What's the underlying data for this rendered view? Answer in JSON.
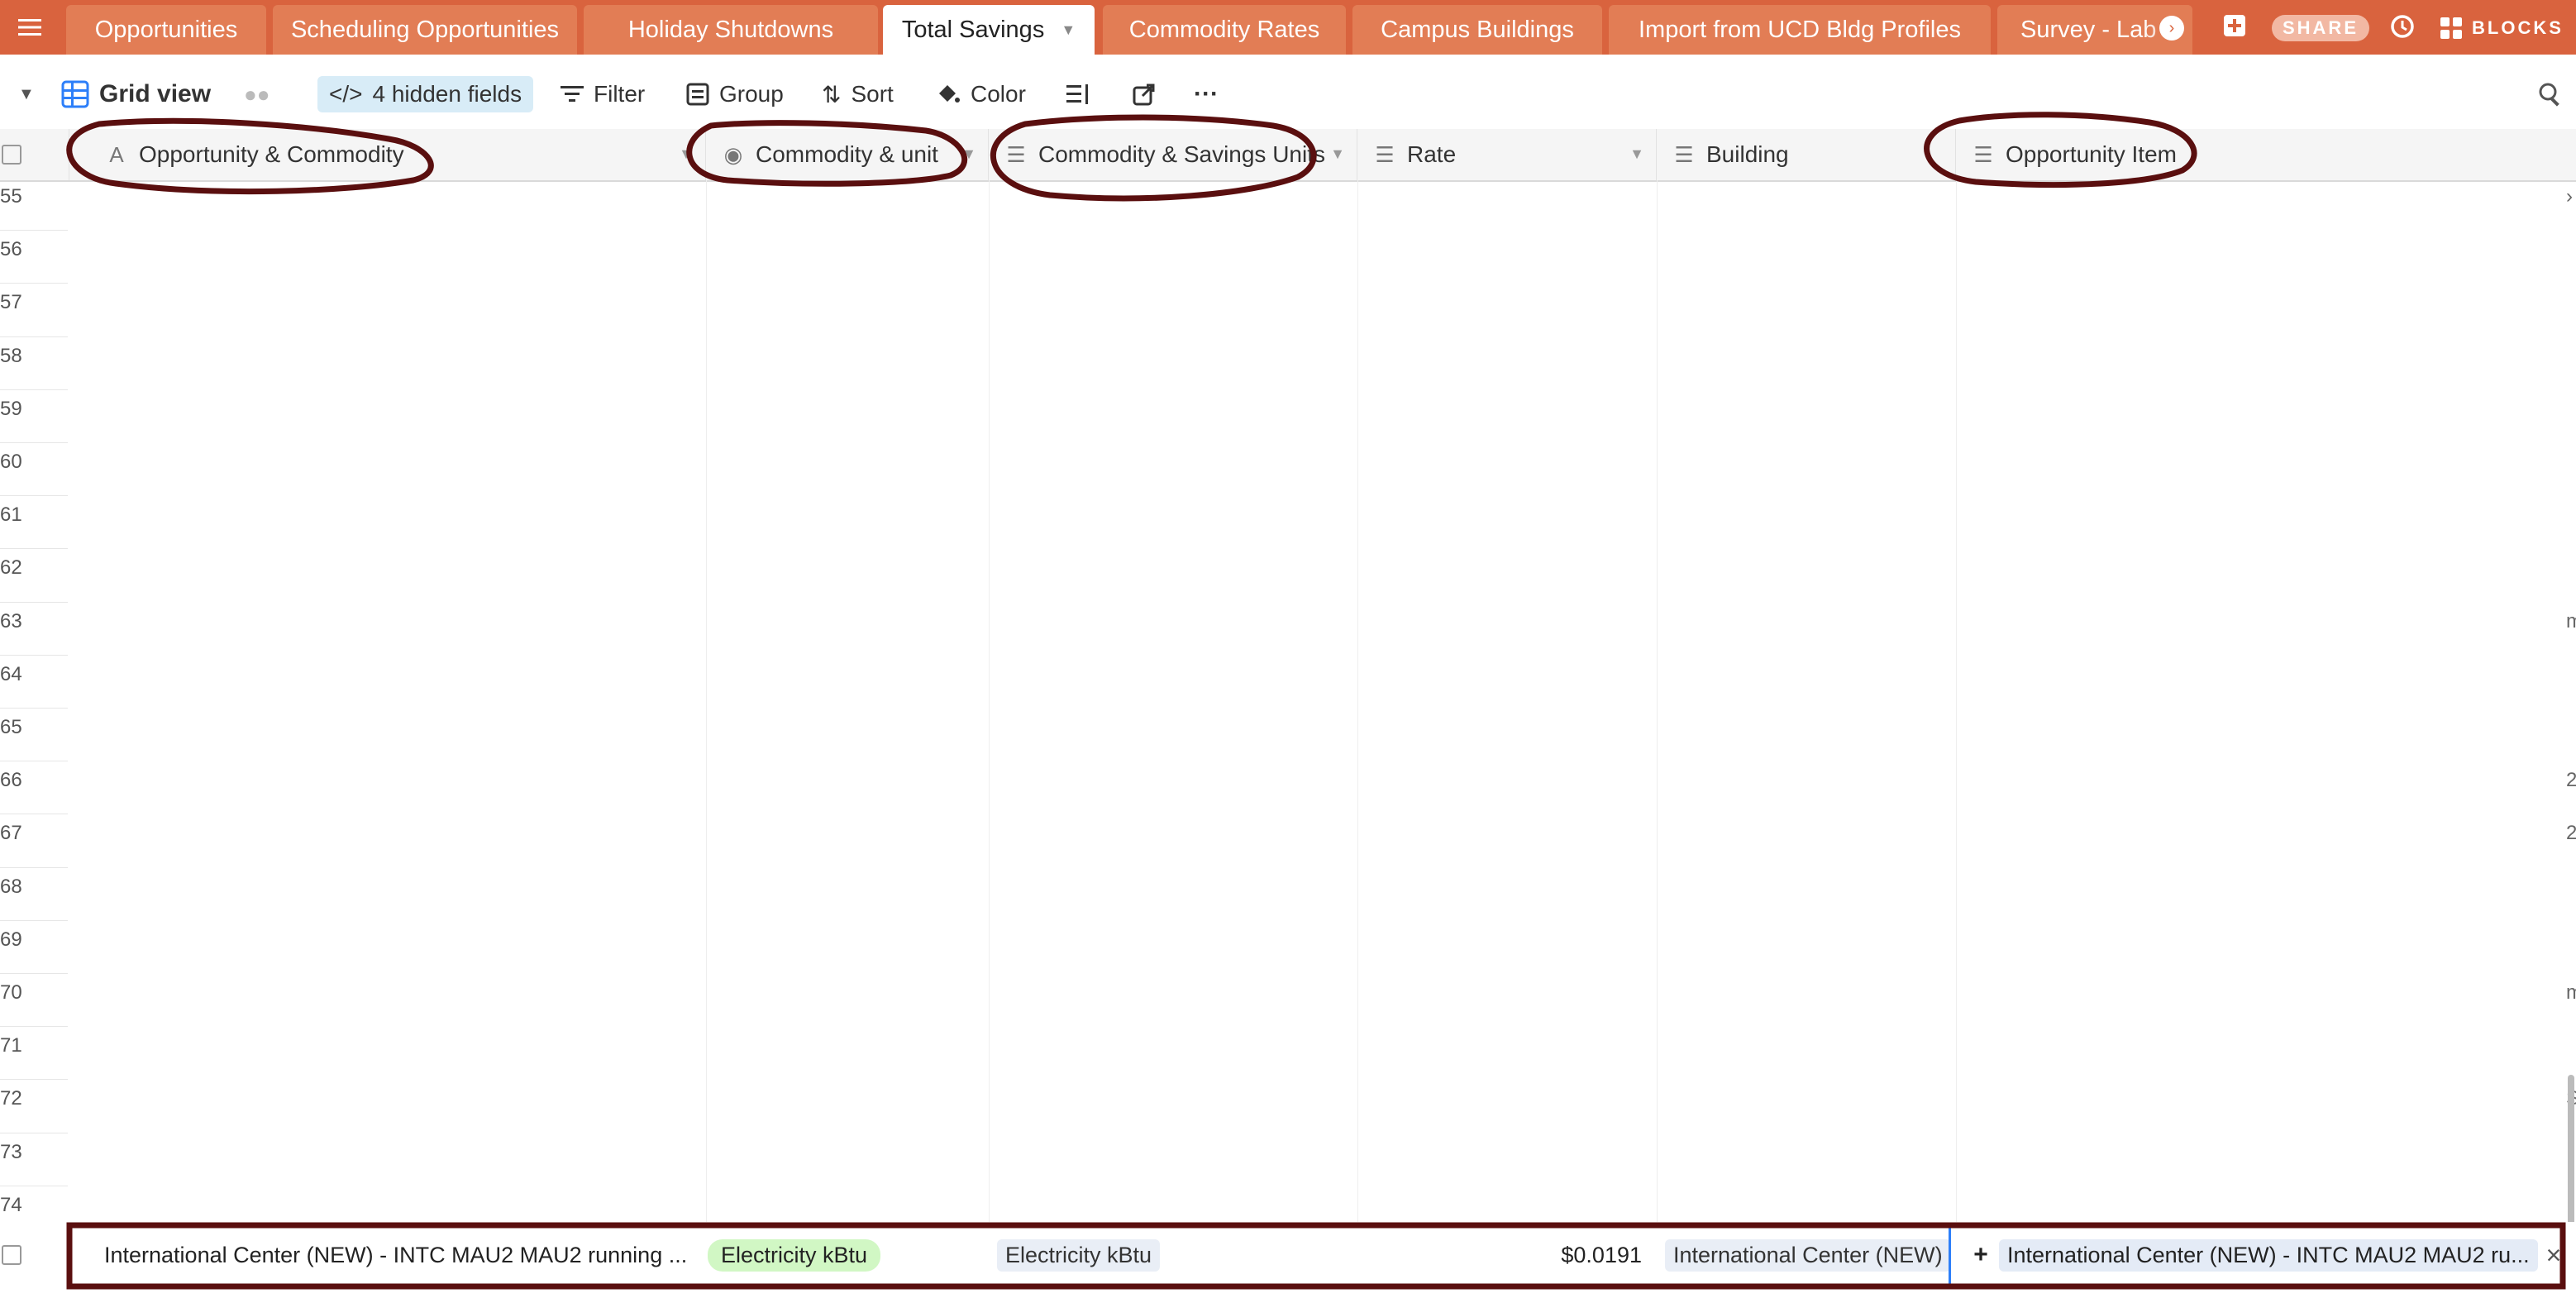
{
  "tabs": [
    {
      "label": "Opportunities"
    },
    {
      "label": "Scheduling Opportunities"
    },
    {
      "label": "Holiday Shutdowns"
    },
    {
      "label": "Total Savings",
      "active": true
    },
    {
      "label": "Commodity Rates"
    },
    {
      "label": "Campus Buildings"
    },
    {
      "label": "Import from UCD Bldg Profiles"
    },
    {
      "label": "Survey - Lab"
    }
  ],
  "topbar": {
    "share_label": "SHARE",
    "blocks_label": "BLOCKS"
  },
  "toolbar": {
    "view_name": "Grid view",
    "hidden_fields": "4 hidden fields",
    "filter": "Filter",
    "group": "Group",
    "sort": "Sort",
    "color": "Color",
    "more": "···"
  },
  "columns": [
    {
      "label": "Opportunity & Commodity",
      "icon": "text-icon"
    },
    {
      "label": "Commodity & unit",
      "icon": "select-icon"
    },
    {
      "label": "Commodity & Savings Units",
      "icon": "lookup-icon"
    },
    {
      "label": "Rate",
      "icon": "lookup-icon"
    },
    {
      "label": "Building",
      "icon": "lookup-icon"
    },
    {
      "label": "Opportunity Item",
      "icon": "link-icon"
    }
  ],
  "row_numbers": [
    "55",
    "56",
    "57",
    "58",
    "59",
    "60",
    "61",
    "62",
    "63",
    "64",
    "65",
    "66",
    "67",
    "68",
    "69",
    "70",
    "71",
    "72",
    "73",
    "74"
  ],
  "right_edge_fragments": [
    "›",
    "m",
    "2",
    "2",
    "m",
    "S"
  ],
  "record": {
    "opportunity_commodity": "International Center (NEW) - INTC MAU2 MAU2 running ...",
    "commodity_unit": "Electricity kBtu",
    "commodity_savings_units": "Electricity kBtu",
    "rate": "$0.0191",
    "building": "International Center (NEW)",
    "add_symbol": "+",
    "opportunity_item": "International Center (NEW) - INTC MAU2 MAU2 ru...",
    "remove_symbol": "×"
  },
  "colors": {
    "tabbar": "#d9633e",
    "annotation": "#5a0f0f",
    "hidden_pill": "#d8ecf7",
    "green_chip": "#d1f7c4"
  }
}
